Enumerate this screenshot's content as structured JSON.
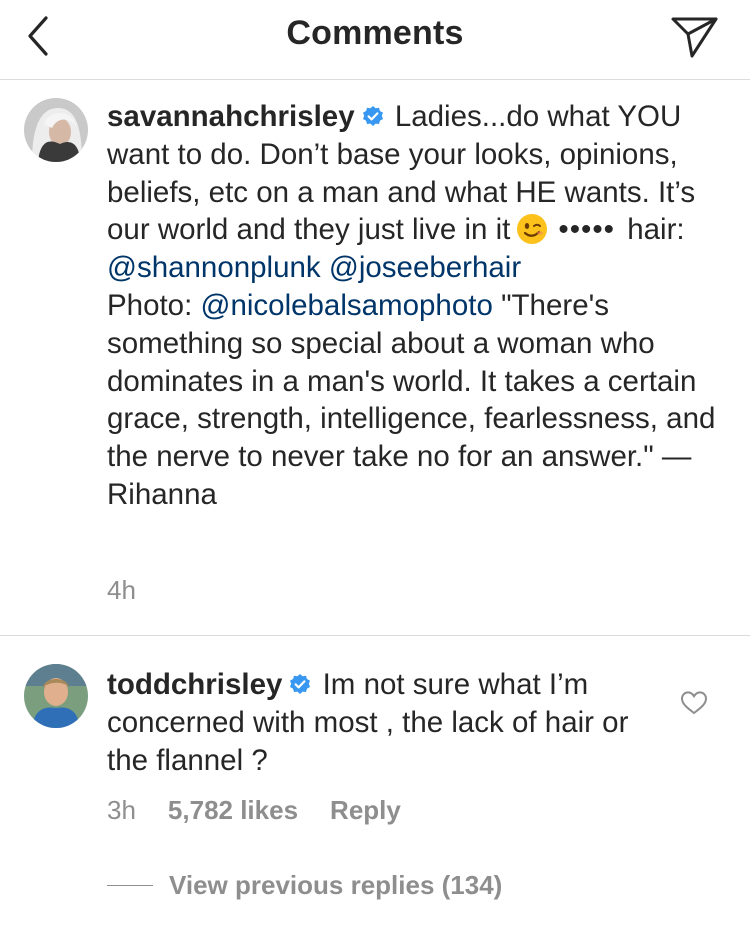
{
  "header": {
    "title": "Comments",
    "back_icon": "chevron-left-icon",
    "share_icon": "paper-plane-icon"
  },
  "caption": {
    "username": "savannahchrisley",
    "verified": true,
    "text_1": "Ladies...do what YOU want to do. Don’t base your looks, opinions, beliefs, etc on a man and what HE wants. It’s our world and they just live in it",
    "emoji": "winking-face",
    "dots": "•••••",
    "text_2": "hair:",
    "mention_1": "@shannonplunk",
    "mention_2": "@joseeberhair",
    "text_3": "Photo:",
    "mention_3": "@nicolebalsamophoto",
    "text_4": "\"There's something so special about a woman who dominates in a man's world. It takes a certain grace, strength, intelligence, fearlessness, and the nerve to never take no for an answer.\" —Rihanna",
    "time": "4h"
  },
  "comment": {
    "username": "toddchrisley",
    "verified": true,
    "text": "Im not sure what I’m concerned with most , the lack of hair or the flannel ?",
    "time": "3h",
    "likes": "5,782 likes",
    "reply_label": "Reply",
    "view_replies": "View previous replies (134)"
  },
  "colors": {
    "text": "#262626",
    "secondary": "#8e8e8e",
    "link": "#003569",
    "verified": "#3897f0",
    "divider": "#dbdbdb"
  }
}
